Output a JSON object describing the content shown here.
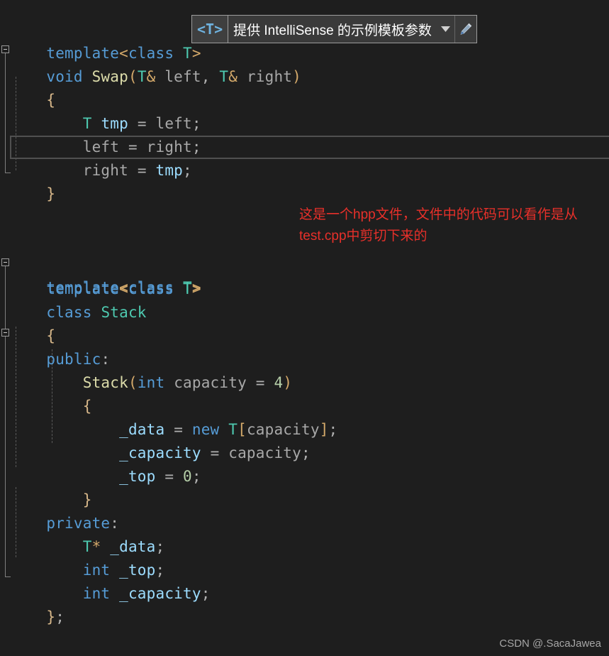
{
  "editor": {
    "background": "#1e1e1e",
    "language": "cpp",
    "file_kind": "hpp",
    "current_line_index": 5,
    "lines": [
      {
        "n": 1,
        "indent": 1,
        "text": "template<class T>"
      },
      {
        "n": 2,
        "indent": 0,
        "text": "void Swap(T& left, T& right)"
      },
      {
        "n": 3,
        "indent": 0,
        "text": "{"
      },
      {
        "n": 4,
        "indent": 1,
        "text": "    T tmp = left;"
      },
      {
        "n": 5,
        "indent": 1,
        "text": "    left = right;"
      },
      {
        "n": 6,
        "indent": 1,
        "text": "    right = tmp;"
      },
      {
        "n": 7,
        "indent": 0,
        "text": "}"
      },
      {
        "n": 8,
        "indent": 0,
        "text": ""
      },
      {
        "n": 9,
        "indent": 0,
        "text": ""
      },
      {
        "n": 10,
        "indent": 1,
        "text": "template<class T>"
      },
      {
        "n": 11,
        "indent": 0,
        "text": "class Stack"
      },
      {
        "n": 12,
        "indent": 0,
        "text": "{"
      },
      {
        "n": 13,
        "indent": 0,
        "text": "public:"
      },
      {
        "n": 14,
        "indent": 1,
        "text": "    Stack(int capacity = 4)"
      },
      {
        "n": 15,
        "indent": 1,
        "text": "    {"
      },
      {
        "n": 16,
        "indent": 2,
        "text": "        _data = new T[capacity];"
      },
      {
        "n": 17,
        "indent": 2,
        "text": "        _capacity = capacity;"
      },
      {
        "n": 18,
        "indent": 2,
        "text": "        _top = 0;"
      },
      {
        "n": 19,
        "indent": 1,
        "text": "    }"
      },
      {
        "n": 20,
        "indent": 0,
        "text": "private:"
      },
      {
        "n": 21,
        "indent": 1,
        "text": "    T* _data;"
      },
      {
        "n": 22,
        "indent": 1,
        "text": "    int _top;"
      },
      {
        "n": 23,
        "indent": 1,
        "text": "    int _capacity;"
      },
      {
        "n": 24,
        "indent": 0,
        "text": "};"
      }
    ],
    "fold_markers": [
      {
        "label": "fold-void-swap",
        "state": "expanded",
        "glyph": "minus"
      },
      {
        "label": "fold-class-stack",
        "state": "expanded",
        "glyph": "minus"
      },
      {
        "label": "fold-stack-ctor",
        "state": "expanded",
        "glyph": "minus"
      }
    ],
    "tokens": {
      "keyword_color": "#569cd6",
      "type_color": "#4ec9b0",
      "function_color": "#dcdcaa",
      "number_color": "#b5cea8",
      "punctuation_color": "#d4a96a",
      "variable_color": "#9cdcfe",
      "plain_color": "#a8a8a8"
    }
  },
  "template_param_tooltip": {
    "param": "<T>",
    "message": "提供 IntelliSense 的示例模板参数",
    "caret_icon": "chevron-down-icon",
    "edit_icon": "pencil-icon",
    "border_color": "#9d9d9d",
    "background": "#3a3a3a",
    "param_color": "#6fb3e0"
  },
  "annotation": {
    "text": "这是一个hpp文件，文件中的代码可以看作是从\ntest.cpp中剪切下来的",
    "color": "#e8302a"
  },
  "watermark": {
    "text": "CSDN @.SacaJawea",
    "color": "#a6a6a6"
  }
}
